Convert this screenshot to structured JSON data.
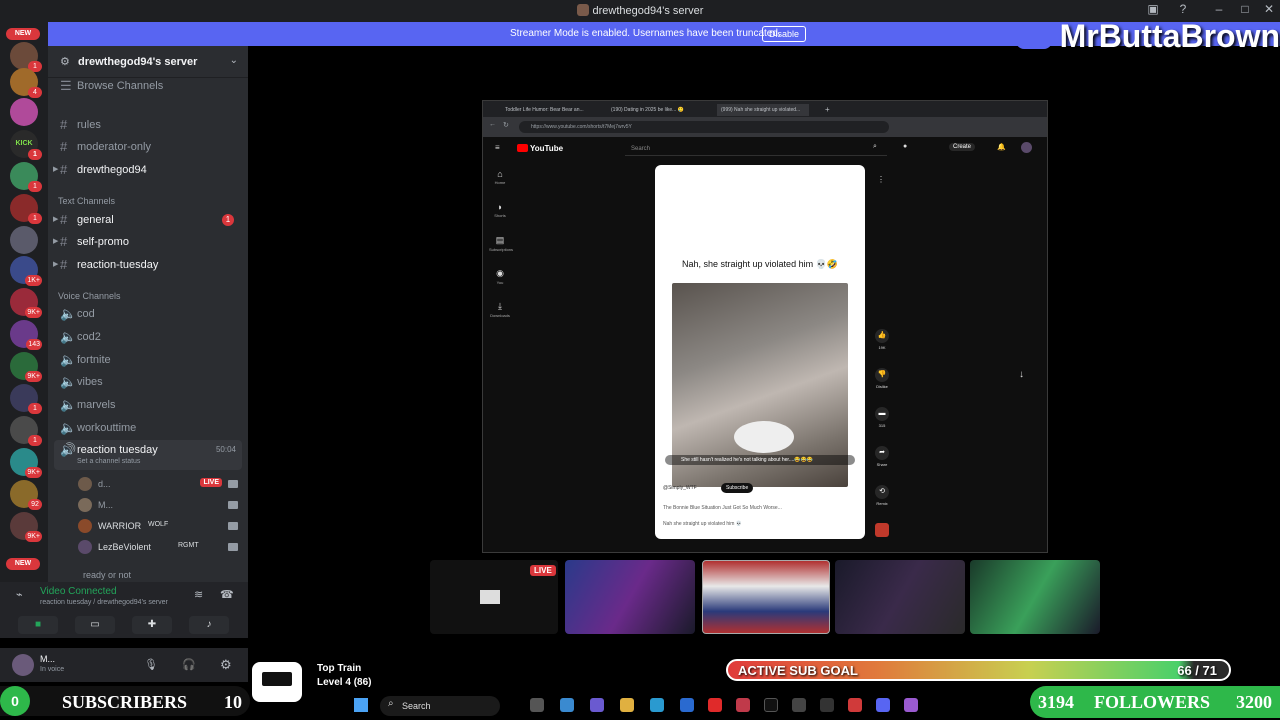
{
  "window": {
    "title": "drewthegod94's server"
  },
  "banner": {
    "message": "Streamer Mode is enabled. Usernames have been truncated.",
    "disable_label": "Disable"
  },
  "overlay": {
    "streamer_name": "MrButtaBrown"
  },
  "rail": {
    "new_label": "NEW",
    "badges": [
      "1",
      "4",
      "1",
      "1",
      "1",
      "1K+",
      "9K+",
      "143",
      "9K+",
      "1",
      "1",
      "9K+",
      "92",
      "9K+"
    ]
  },
  "server": {
    "name": "drewthegod94's server",
    "browse_label": "Browse Channels",
    "top_channels": [
      "rules",
      "moderator-only",
      "drewthegod94"
    ],
    "text_category": "Text Channels",
    "text_channels": [
      "general",
      "self-promo",
      "reaction-tuesday"
    ],
    "general_unread": "1",
    "voice_category": "Voice Channels",
    "voice_channels": [
      "cod",
      "cod2",
      "fortnite",
      "vibes",
      "marvels",
      "workouttime"
    ],
    "active_voice": {
      "name": "reaction tuesday",
      "timer": "50:04",
      "status": "Set a channel status"
    },
    "voice_users": [
      {
        "name": "d...",
        "badge": "LIVE"
      },
      {
        "name": "M..."
      },
      {
        "name": "WARRIOR",
        "tag": "WOLF"
      },
      {
        "name": "LezBeViolent",
        "tag": "RGMT"
      }
    ],
    "next_channel": "ready or not"
  },
  "voice_panel": {
    "status": "Video Connected",
    "sub": "reaction tuesday / drewthegod94's server"
  },
  "user_panel": {
    "name": "M...",
    "status": "In voice"
  },
  "browser": {
    "tabs": [
      "Toddler Life Humor: Bear Bear an...",
      "(190) Dating in 2025 be like... 🥲",
      "(999) Nah she straight up violated..."
    ],
    "url": "https://www.youtube.com/shorts/t7Mej7wrv5Y",
    "youtube": {
      "logo": "YouTube",
      "search_placeholder": "Search",
      "create_label": "Create",
      "nav": [
        "Home",
        "Shorts",
        "Subscriptions",
        "You",
        "Downloads"
      ],
      "short_caption": "Nah, she straight up violated him 💀🤣",
      "overlay_text": "She still hasn't realized he's not talking about her....😂😂😂",
      "channel": "@Simply_WTF",
      "subscribe_label": "Subscribe",
      "line1": "The Bonnie Blue Situation Just Got So Much Worse...",
      "line2": "Nah she straight up violated him 💀",
      "actions": [
        "19K",
        "Dislike",
        "315",
        "Share",
        "Remix"
      ]
    }
  },
  "cams": {
    "live_label": "LIVE"
  },
  "sub_goal": {
    "label": "ACTIVE SUB GOAL",
    "count": "66 / 71",
    "progress": 0.93
  },
  "subscribers": {
    "count_left": "0",
    "label": "SUBSCRIBERS",
    "count_right": "10"
  },
  "top_train": {
    "title": "Top Train",
    "level": "Level 4  (86)"
  },
  "taskbar": {
    "search": "Search"
  },
  "followers": {
    "current": "3194",
    "label": "FOLLOWERS",
    "goal": "3200"
  }
}
